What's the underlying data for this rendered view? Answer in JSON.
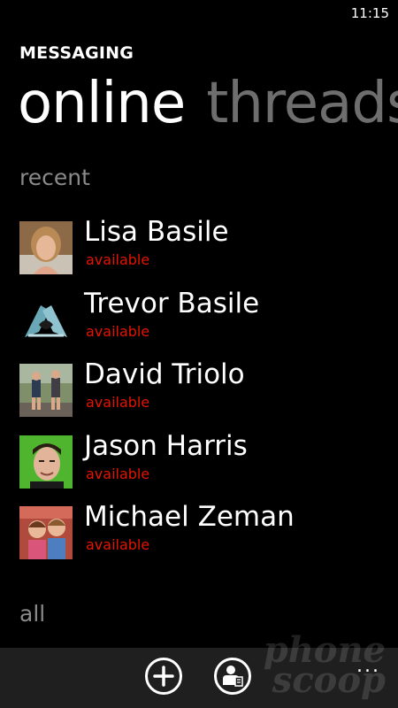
{
  "status_bar": {
    "time": "11:15"
  },
  "app": {
    "title": "MESSAGING"
  },
  "pivot": {
    "tabs": [
      {
        "label": "online"
      },
      {
        "label": "threads"
      }
    ]
  },
  "sections": {
    "recent": "recent",
    "all": "all"
  },
  "contacts": [
    {
      "name": "Lisa Basile",
      "status": "available",
      "avatar": "woman-photo"
    },
    {
      "name": "Trevor Basile",
      "status": "available",
      "avatar": "hands-heart-photo"
    },
    {
      "name": "David Triolo",
      "status": "available",
      "avatar": "runners-photo"
    },
    {
      "name": "Jason Harris",
      "status": "available",
      "avatar": "man-green-background-photo"
    },
    {
      "name": "Michael Zeman",
      "status": "available",
      "avatar": "two-girls-photo"
    }
  ],
  "app_bar": {
    "buttons": [
      {
        "icon": "add-icon"
      },
      {
        "icon": "contact-icon"
      }
    ],
    "more": "..."
  },
  "watermark": {
    "line1": "phone",
    "line2": "scoop"
  },
  "colors": {
    "status": "#e51400",
    "inactive_pivot": "#6e6e6e",
    "section_label": "#8a8a8a"
  }
}
